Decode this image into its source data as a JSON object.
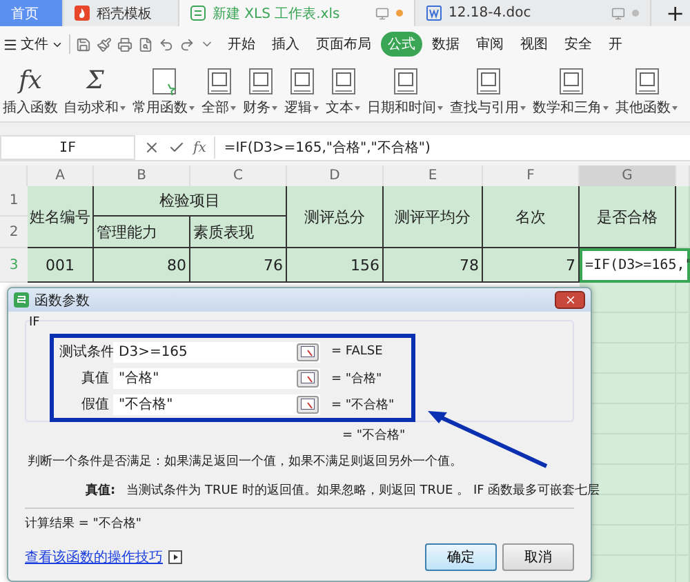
{
  "tabs": [
    {
      "label": "首页",
      "kind": "home",
      "selected": false
    },
    {
      "label": "稻壳模板",
      "kind": "docer",
      "selected": false
    },
    {
      "label": "新建 XLS 工作表.xls",
      "kind": "sheet",
      "selected": true
    },
    {
      "label": "12.18-4.doc",
      "kind": "doc",
      "selected": false
    }
  ],
  "new_tab": "+",
  "menu": {
    "file": "文件",
    "tabs": [
      {
        "label": "开始",
        "selected": false
      },
      {
        "label": "插入",
        "selected": false
      },
      {
        "label": "页面布局",
        "selected": false
      },
      {
        "label": "公式",
        "selected": true
      },
      {
        "label": "数据",
        "selected": false
      },
      {
        "label": "审阅",
        "selected": false
      },
      {
        "label": "视图",
        "selected": false
      },
      {
        "label": "安全",
        "selected": false
      },
      {
        "label": "开",
        "selected": false
      }
    ]
  },
  "ribbon": [
    {
      "label": "插入函数",
      "kind": "glyph",
      "glyph": "fx",
      "dropdown": false
    },
    {
      "label": "自动求和",
      "kind": "glyph",
      "glyph": "Σ",
      "dropdown": true
    },
    {
      "label": "常用函数",
      "kind": "star",
      "dropdown": true
    },
    {
      "label": "全部",
      "kind": "book",
      "dropdown": true
    },
    {
      "label": "财务",
      "kind": "book",
      "dropdown": true
    },
    {
      "label": "逻辑",
      "kind": "book",
      "dropdown": true
    },
    {
      "label": "文本",
      "kind": "book",
      "dropdown": true
    },
    {
      "label": "日期和时间",
      "kind": "book",
      "dropdown": true
    },
    {
      "label": "查找与引用",
      "kind": "book",
      "dropdown": true
    },
    {
      "label": "数学和三角",
      "kind": "book",
      "dropdown": true
    },
    {
      "label": "其他函数",
      "kind": "book",
      "dropdown": true
    }
  ],
  "formula_bar": {
    "name_box": "IF",
    "fx": "fx",
    "formula": "=IF(D3>=165,\"合格\",\"不合格\")"
  },
  "sheet": {
    "columns": [
      {
        "label": "A",
        "selected": false
      },
      {
        "label": "B",
        "selected": false
      },
      {
        "label": "C",
        "selected": false
      },
      {
        "label": "D",
        "selected": false
      },
      {
        "label": "E",
        "selected": false
      },
      {
        "label": "F",
        "selected": false
      },
      {
        "label": "G",
        "selected": true
      }
    ],
    "row_numbers": [
      {
        "label": "1",
        "selected": false
      },
      {
        "label": "2",
        "selected": false
      },
      {
        "label": "3",
        "selected": true
      }
    ],
    "header": [
      "姓名编号",
      "检验项目",
      "测评总分",
      "测评平均分",
      "名次",
      "是否合格"
    ],
    "subheader": [
      "管理能力",
      "素质表现"
    ],
    "row": [
      "001",
      "80",
      "76",
      "156",
      "78",
      "7"
    ],
    "editing_cell": "=IF(D3>=165,\""
  },
  "dialog": {
    "title": "函数参数",
    "function": "IF",
    "args": [
      {
        "label": "测试条件",
        "value": "D3>=165",
        "result": "= FALSE"
      },
      {
        "label": "真值",
        "value": "\"合格\"",
        "result": "= \"合格\""
      },
      {
        "label": "假值",
        "value": "\"不合格\"",
        "result": "= \"不合格\""
      }
    ],
    "formula_result": "= \"不合格\"",
    "description": "判断一个条件是否满足：如果满足返回一个值，如果不满足则返回另外一个值。",
    "param_name": "真值:",
    "param_description": "当测试条件为 TRUE 时的返回值。如果忽略，则返回 TRUE 。 IF 函数最多可嵌套七层",
    "calc_result": "计算结果 = \"不合格\"",
    "help_link": "查看该函数的操作技巧",
    "buttons": [
      "确定",
      "取消"
    ]
  }
}
